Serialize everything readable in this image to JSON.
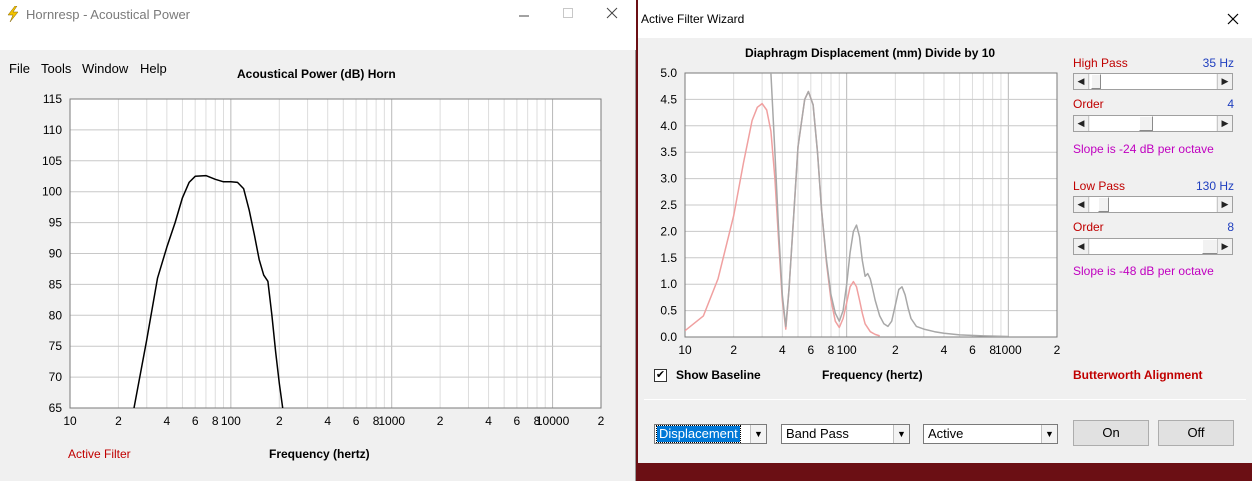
{
  "left_window": {
    "title": "Hornresp - Acoustical Power",
    "menu": [
      "File",
      "Tools",
      "Window",
      "Help"
    ],
    "status_text": "Active Filter",
    "chart": {
      "title": "Acoustical Power (dB)   Horn",
      "xlabel": "Frequency (hertz)",
      "y_ticks": [
        "115",
        "110",
        "105",
        "100",
        "95",
        "90",
        "85",
        "80",
        "75",
        "70",
        "65"
      ],
      "x_ticks": [
        "10",
        "2",
        "4",
        "6",
        "8",
        "100",
        "2",
        "4",
        "6",
        "8",
        "1000",
        "2",
        "4",
        "6",
        "8",
        "10000",
        "2"
      ]
    }
  },
  "right_window": {
    "title": "Active Filter Wizard",
    "chart": {
      "title": "Diaphragm Displacement (mm)    Divide by 10",
      "xlabel": "Frequency (hertz)",
      "y_ticks": [
        "5.0",
        "4.5",
        "4.0",
        "3.5",
        "3.0",
        "2.5",
        "2.0",
        "1.5",
        "1.0",
        "0.5",
        "0.0"
      ],
      "x_ticks": [
        "10",
        "2",
        "4",
        "6",
        "8",
        "100",
        "2",
        "4",
        "6",
        "8",
        "1000",
        "2"
      ]
    },
    "high_pass": {
      "label": "High Pass",
      "value": "35 Hz",
      "order_label": "Order",
      "order": "4",
      "slope": "Slope is -24 dB per octave"
    },
    "low_pass": {
      "label": "Low Pass",
      "value": "130 Hz",
      "order_label": "Order",
      "order": "8",
      "slope": "Slope is -48 dB per octave"
    },
    "alignment": "Butterworth Alignment",
    "show_baseline": {
      "label": "Show Baseline",
      "checked": true,
      "check_glyph": "✔"
    },
    "dropdowns": {
      "plot": "Displacement",
      "filter_type": "Band Pass",
      "mode": "Active"
    },
    "buttons": {
      "on": "On",
      "off": "Off"
    }
  },
  "chart_data": [
    {
      "type": "line",
      "title": "Acoustical Power (dB)   Horn",
      "xlabel": "Frequency (hertz)",
      "ylabel": "",
      "x_scale": "log",
      "xlim": [
        10,
        20000
      ],
      "ylim": [
        65,
        115
      ],
      "grid": true,
      "series": [
        {
          "color": "#000000",
          "x": [
            25,
            30,
            35,
            40,
            45,
            50,
            55,
            60,
            70,
            80,
            90,
            100,
            110,
            120,
            130,
            140,
            150,
            160,
            170,
            180,
            190,
            200,
            210
          ],
          "y": [
            65,
            76,
            86,
            91,
            95,
            99,
            101.5,
            102.5,
            102.6,
            102,
            101.6,
            101.6,
            101.5,
            100.5,
            97,
            93,
            89,
            86.5,
            85.5,
            80,
            74,
            69,
            65
          ]
        }
      ]
    },
    {
      "type": "line",
      "title": "Diaphragm Displacement (mm)    Divide by 10",
      "xlabel": "Frequency (hertz)",
      "ylabel": "",
      "x_scale": "log",
      "xlim": [
        10,
        2000
      ],
      "ylim": [
        0,
        5
      ],
      "grid": true,
      "series": [
        {
          "color": "#f0a0a0",
          "x": [
            10,
            13,
            16,
            20,
            23,
            26,
            28,
            30,
            32,
            34,
            36,
            38,
            40,
            42,
            44,
            47,
            50,
            55,
            58,
            62,
            66,
            70,
            75,
            80,
            85,
            90,
            95,
            100,
            105,
            110,
            115,
            120,
            125,
            130,
            140,
            150,
            160
          ],
          "y": [
            0.12,
            0.4,
            1.1,
            2.3,
            3.3,
            4.1,
            4.35,
            4.42,
            4.3,
            3.9,
            3.0,
            1.8,
            0.7,
            0.15,
            0.9,
            2.3,
            3.6,
            4.5,
            4.65,
            4.4,
            3.5,
            2.4,
            1.4,
            0.7,
            0.3,
            0.18,
            0.35,
            0.65,
            0.95,
            1.05,
            0.95,
            0.7,
            0.45,
            0.25,
            0.1,
            0.05,
            0.02
          ]
        },
        {
          "color": "#a8a8a8",
          "x": [
            34,
            36,
            38,
            40,
            42,
            44,
            47,
            50,
            55,
            58,
            62,
            66,
            70,
            75,
            80,
            85,
            90,
            95,
            100,
            105,
            110,
            115,
            120,
            125,
            130,
            135,
            140,
            145,
            150,
            160,
            170,
            180,
            190,
            200,
            210,
            220,
            230,
            240,
            250,
            270,
            300,
            350,
            400,
            500,
            700,
            1000
          ],
          "y": [
            5.0,
            3.5,
            2.0,
            0.8,
            0.2,
            0.9,
            2.3,
            3.6,
            4.5,
            4.65,
            4.4,
            3.5,
            2.4,
            1.45,
            0.8,
            0.45,
            0.3,
            0.5,
            1.0,
            1.6,
            2.0,
            2.12,
            1.9,
            1.45,
            1.15,
            1.2,
            1.1,
            0.9,
            0.7,
            0.4,
            0.25,
            0.2,
            0.3,
            0.6,
            0.9,
            0.95,
            0.8,
            0.55,
            0.35,
            0.2,
            0.15,
            0.1,
            0.07,
            0.04,
            0.02,
            0.01
          ]
        }
      ]
    }
  ]
}
